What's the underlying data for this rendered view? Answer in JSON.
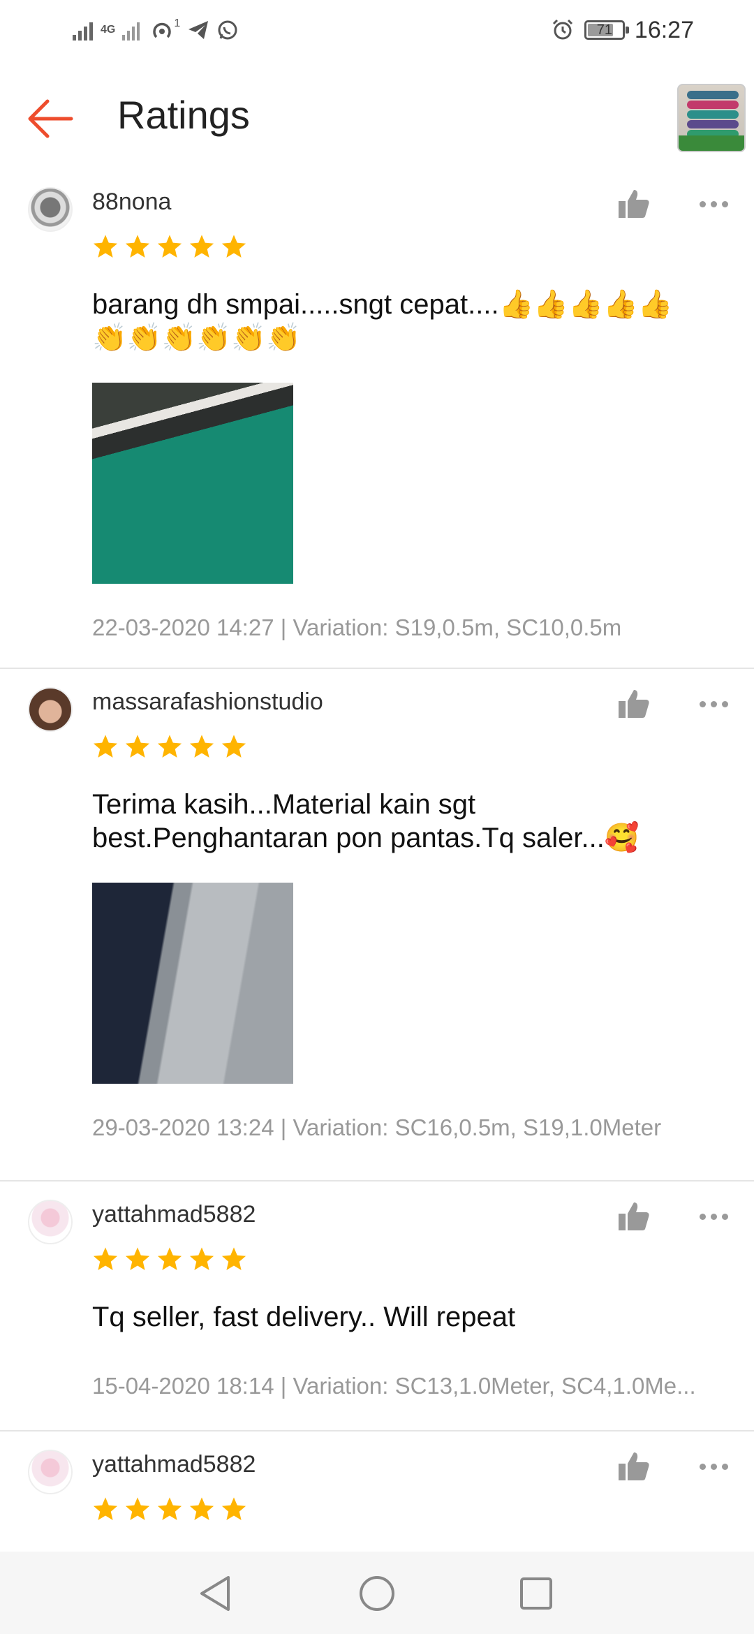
{
  "status_bar": {
    "network_label": "4G",
    "notification_count": "1",
    "battery": "71",
    "time": "16:27"
  },
  "header": {
    "title": "Ratings"
  },
  "reviews": [
    {
      "username": "88nona",
      "rating": 5,
      "comment": "barang dh smpai.....sngt cepat....👍👍👍👍👍👏👏👏👏👏👏",
      "meta": "22-03-2020 14:27 | Variation: S19,0.5m, SC10,0.5m"
    },
    {
      "username": "massarafashionstudio",
      "rating": 5,
      "comment": "Terima kasih...Material kain sgt best.Penghantaran pon pantas.Tq saler...🥰",
      "meta": "29-03-2020 13:24 | Variation: SC16,0.5m, S19,1.0Meter"
    },
    {
      "username": "yattahmad5882",
      "rating": 5,
      "comment": "Tq seller, fast delivery.. Will repeat",
      "meta": "15-04-2020 18:14 | Variation: SC13,1.0Meter, SC4,1.0Me..."
    },
    {
      "username": "yattahmad5882",
      "rating": 5
    }
  ],
  "colors": {
    "accent": "#ee4d2d",
    "star": "#ffb400",
    "meta_text": "#999999"
  }
}
